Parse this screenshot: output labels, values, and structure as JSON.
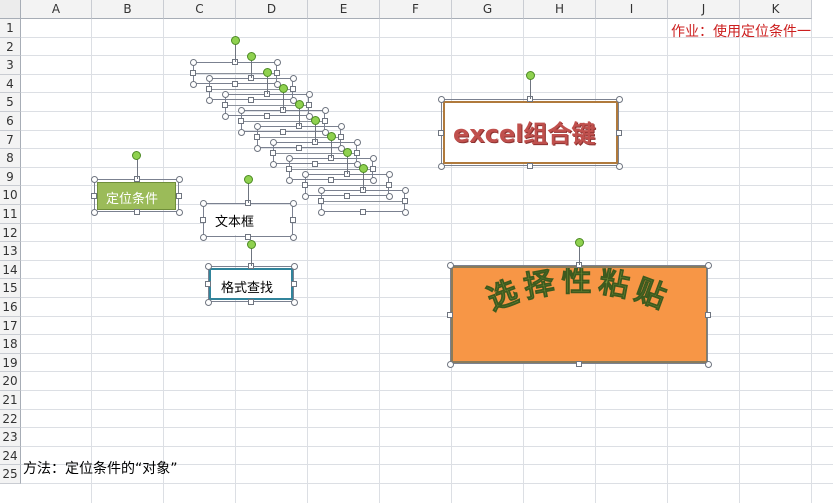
{
  "columns": [
    "A",
    "B",
    "C",
    "D",
    "E",
    "F",
    "G",
    "H",
    "I",
    "J",
    "K"
  ],
  "rows": [
    "1",
    "2",
    "3",
    "4",
    "5",
    "6",
    "7",
    "8",
    "9",
    "10",
    "11",
    "12",
    "13",
    "14",
    "15",
    "16",
    "17",
    "18",
    "19",
    "20",
    "21",
    "22",
    "23",
    "24",
    "25"
  ],
  "cells": {
    "j1_task": "作业：使用定位条件一",
    "a24_method": "方法：定位条件的“对象”"
  },
  "shapes": {
    "green_box_label": "定位条件",
    "textbox_label": "文本框",
    "format_find_label": "格式查找",
    "wordart_combo": "excel组合键",
    "wordart_arc": "选择性粘贴"
  },
  "colors": {
    "task_text": "#cc1f1f",
    "green_fill": "#9bbb59",
    "orange_fill": "#f79646",
    "wordart_red": "#c0504d",
    "wordart_olive": "#76923c",
    "teal_border": "#31849b"
  }
}
